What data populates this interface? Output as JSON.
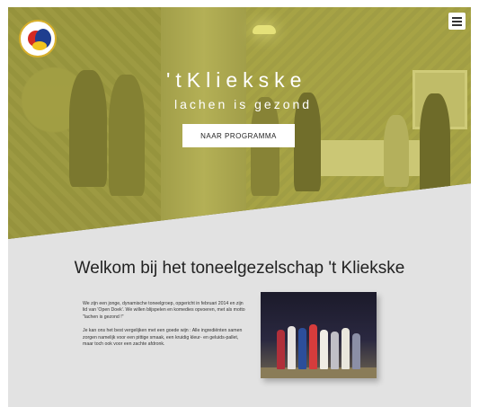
{
  "site": {
    "hero_title": "'tKliekske",
    "hero_subtitle": "lachen is gezond",
    "cta_label": "NAAR PROGRAMMA",
    "logo_icon": "theater-logo-icon",
    "menu_icon": "hamburger-menu-icon"
  },
  "welcome": {
    "heading": "Welkom bij het toneelgezelschap 't Kliekske",
    "paragraph_1": "We zijn een jonge, dynamische toneelgroep, opgericht in februari 2014 en zijn lid van 'Open Doek'. We willen blijspelen en komedies opvoeren, met als motto \"lachen is gezond !\"",
    "paragraph_2": "Je kan ons het best vergelijken met een goede wijn : Alle ingrediënten samen zorgen namelijk voor een pittige smaak, een kruidig kleur- en geluids-pallet, maar toch ook voor een zachte afdronk."
  },
  "colors": {
    "hero_tint": "#cec93c",
    "section_bg": "#e2e2e2",
    "text": "#222222"
  }
}
